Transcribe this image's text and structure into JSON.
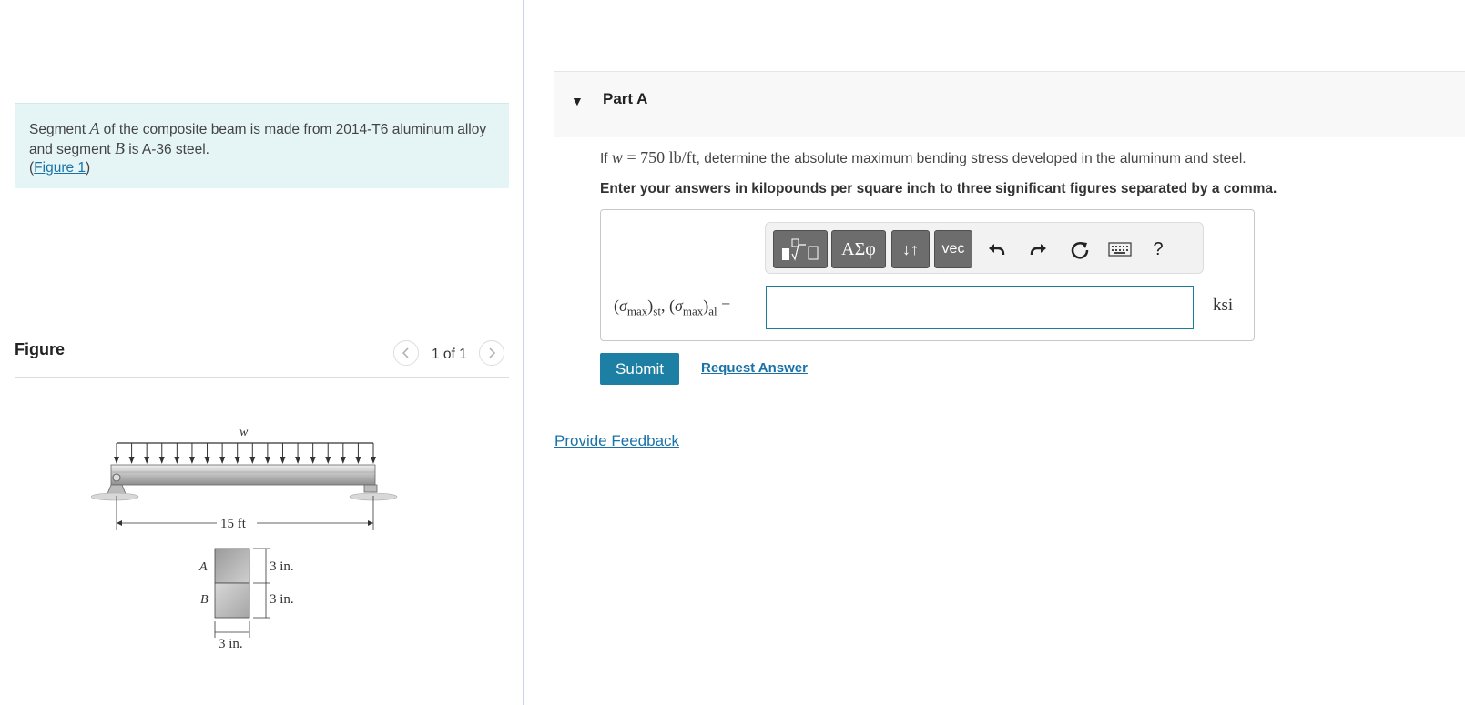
{
  "problem": {
    "text_1": "Segment ",
    "var_a": "A",
    "text_2": " of the composite beam is made from 2014-T6 aluminum alloy and segment ",
    "var_b": "B",
    "text_3": " is A-36 steel.",
    "figure_link_open": "(",
    "figure_link": "Figure 1",
    "figure_link_close": ")"
  },
  "figure": {
    "title": "Figure",
    "pager": "1 of 1",
    "prev_icon": "chevron-left-icon",
    "next_icon": "chevron-right-icon",
    "labels": {
      "load": "w",
      "span": "15 ft",
      "seg_a": "A",
      "seg_b": "B",
      "h_a": "3 in.",
      "h_b": "3 in.",
      "width": "3 in."
    }
  },
  "part": {
    "title": "Part A",
    "caret_icon": "caret-down-icon",
    "question_prefix": "If ",
    "question_var": "w",
    "question_eq": " = 750 ",
    "question_unit": "lb/ft",
    "question_suffix": ", determine the absolute maximum bending stress developed in the aluminum and steel.",
    "instructions": "Enter your answers in kilopounds per square inch to three significant figures separated by a comma."
  },
  "toolbar": {
    "templates_icon": "templates-icon",
    "greek_label": "ΑΣφ",
    "arrows_label": "↓↑",
    "vec_label": "vec",
    "undo_icon": "undo-icon",
    "redo_icon": "redo-icon",
    "reset_icon": "reset-icon",
    "keyboard_icon": "keyboard-icon",
    "help_label": "?"
  },
  "answer": {
    "lhs": "(σmax)st, (σmax)al =",
    "value": "",
    "unit": "ksi"
  },
  "actions": {
    "submit": "Submit",
    "request_answer": "Request Answer",
    "feedback": "Provide Feedback"
  }
}
